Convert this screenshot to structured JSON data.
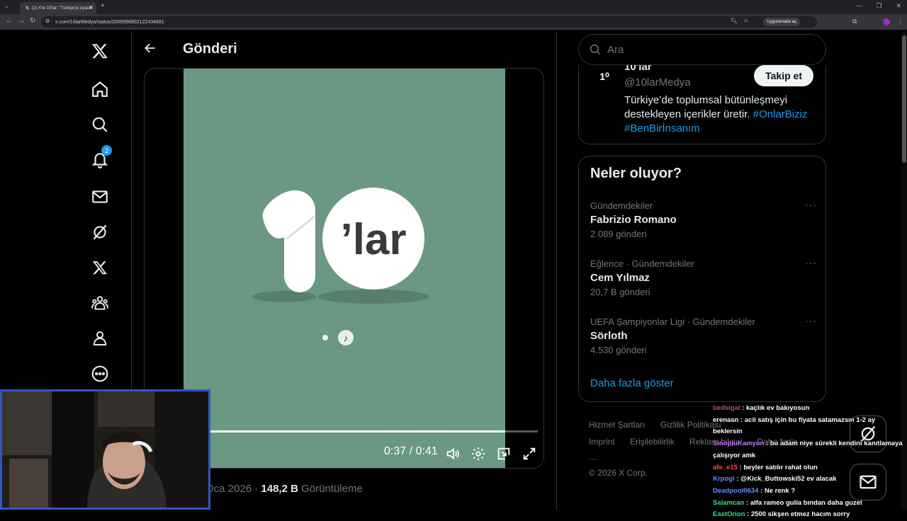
{
  "browser": {
    "tab_title": "(2) X'te 10'lar: \"Türkiye'yi ziyaret",
    "url": "x.com/10larMedya/status/2006998902122434681",
    "open_in_app": "Uygulamada aç"
  },
  "left_nav": {
    "notification_count": "2"
  },
  "post": {
    "header_title": "Gönderi",
    "video_time": "0:37 / 0:41",
    "progress": 0.9,
    "date_partial": "Oca 2026",
    "view_count": "148,2 B",
    "view_label": "Görüntüleme",
    "video_logo_text": "’lar"
  },
  "search": {
    "placeholder": "Ara"
  },
  "profile": {
    "name": "10'lar",
    "handle": "@10larMedya",
    "follow_label": "Takip et",
    "bio": "Türkiye’de toplumsal bütünleşmeyi destekleyen içerikler üretir.",
    "hashtag1": "#OnlarBiziz",
    "hashtag2": "#BenBirİnsanım"
  },
  "trends": {
    "title": "Neler oluyor?",
    "items": [
      {
        "category": "Gündemdekiler",
        "name": "Fabrizio Romano",
        "count": "2.089 gönderi"
      },
      {
        "category": "Eğlence · Gündemdekiler",
        "name": "Cem Yılmaz",
        "count": "20,7 B gönderi"
      },
      {
        "category": "UEFA Şampiyonlar Ligi · Gündemdekiler",
        "name": "Sörloth",
        "count": "4.530 gönderi"
      }
    ],
    "show_more": "Daha fazla göster"
  },
  "footer": {
    "terms": "Hizmet Şartları",
    "privacy": "Gizlilik Politikası",
    "imprint": "Imprint",
    "accessibility": "Erişilebilirlik",
    "ads": "Reklam bilgisi",
    "more": "Daha fazla ···",
    "copyright": "© 2026 X Corp."
  },
  "chat": [
    {
      "user": "bedsigal",
      "color": "#b7507a",
      "msg": ": kaçlık ev bakıyosun"
    },
    {
      "user": "erenasn",
      "color": "#ffffff",
      "msg": ": acil satış için bu fiyata satamazsın 1-2 ay beklersin"
    },
    {
      "user": "SinopluKamyon",
      "color": "#c77dff",
      "msg": ": bu adam niye sürekli kendini kanıtlamaya çalışıyor amk"
    },
    {
      "user": "afe_e15",
      "color": "#ff4b4b",
      "msg": ": beyler satılır rahat olun"
    },
    {
      "user": "Krpogl",
      "color": "#6a8cff",
      "msg": ": @Kick_Buttowski52 ev alacak"
    },
    {
      "user": "Deadpool0634",
      "color": "#6a8cff",
      "msg": ": Ne renk ?"
    },
    {
      "user": "Salamcan",
      "color": "#3ddc84",
      "msg": ": alfa rameo gulia bından daha guzel"
    },
    {
      "user": "EastOrion",
      "color": "#3ddc84",
      "msg": ": 2500 sikşen etmez hacım sorry"
    }
  ],
  "colors": {
    "accent": "#1d9bf0",
    "video_bg": "#6b9882",
    "webcam_border": "#2e57c2"
  }
}
